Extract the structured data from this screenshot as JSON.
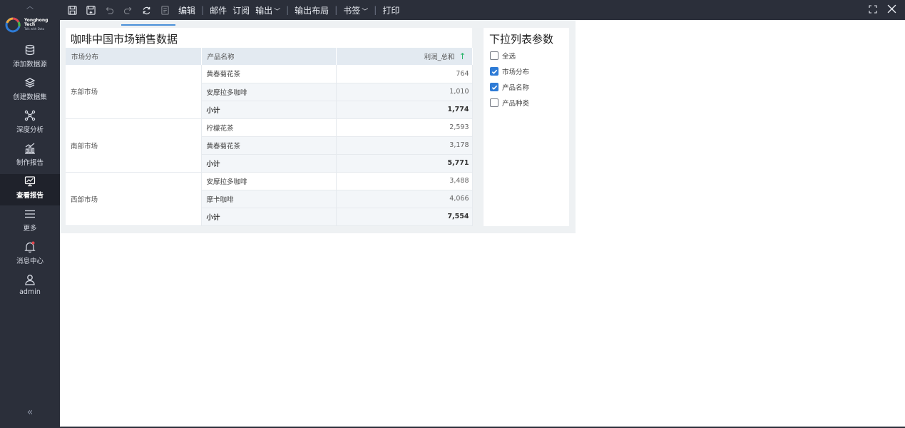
{
  "sidebar": {
    "logo": {
      "name": "Yonghong Tech",
      "tagline": "Talk with Data"
    },
    "items": [
      {
        "label": "添加数据源",
        "icon": "database-icon"
      },
      {
        "label": "创建数据集",
        "icon": "layers-icon"
      },
      {
        "label": "深度分析",
        "icon": "nodes-icon"
      },
      {
        "label": "制作报告",
        "icon": "report-chart-icon"
      },
      {
        "label": "查看报告",
        "icon": "monitor-chart-icon",
        "active": true
      },
      {
        "label": "更多",
        "icon": "menu-icon"
      },
      {
        "label": "消息中心",
        "icon": "bell-icon",
        "has_dot": true
      },
      {
        "label": "admin",
        "icon": "user-icon"
      }
    ],
    "collapse_label": "«"
  },
  "toolbar": {
    "edit": "编辑",
    "mail": "邮件",
    "subscribe": "订阅",
    "export": "输出",
    "export_layout": "输出布局",
    "bookmark": "书签",
    "print": "打印"
  },
  "report": {
    "table_title": "咖啡中国市场销售数据",
    "columns": [
      "市场分布",
      "产品名称",
      "利润_总和"
    ],
    "groups": [
      {
        "market": "东部市场",
        "rows": [
          {
            "product": "黄春菊花茶",
            "value": "764"
          },
          {
            "product": "安摩拉多咖啡",
            "value": "1,010"
          },
          {
            "product": "小计",
            "value": "1,774"
          }
        ]
      },
      {
        "market": "南部市场",
        "rows": [
          {
            "product": "柠檬花茶",
            "value": "2,593"
          },
          {
            "product": "黄春菊花茶",
            "value": "3,178"
          },
          {
            "product": "小计",
            "value": "5,771"
          }
        ]
      },
      {
        "market": "西部市场",
        "rows": [
          {
            "product": "安摩拉多咖啡",
            "value": "3,488"
          },
          {
            "product": "摩卡咖啡",
            "value": "4,066"
          },
          {
            "product": "小计",
            "value": "7,554"
          }
        ]
      }
    ]
  },
  "param": {
    "title": "下拉列表参数",
    "options": [
      {
        "label": "全选",
        "checked": false
      },
      {
        "label": "市场分布",
        "checked": true
      },
      {
        "label": "产品名称",
        "checked": true
      },
      {
        "label": "产品种类",
        "checked": false
      }
    ]
  },
  "colors": {
    "sidebar_bg": "#2b2f3a",
    "accent": "#2e7bd6",
    "sort_arrow": "#2ab46a",
    "notify_dot": "#e0454d"
  }
}
